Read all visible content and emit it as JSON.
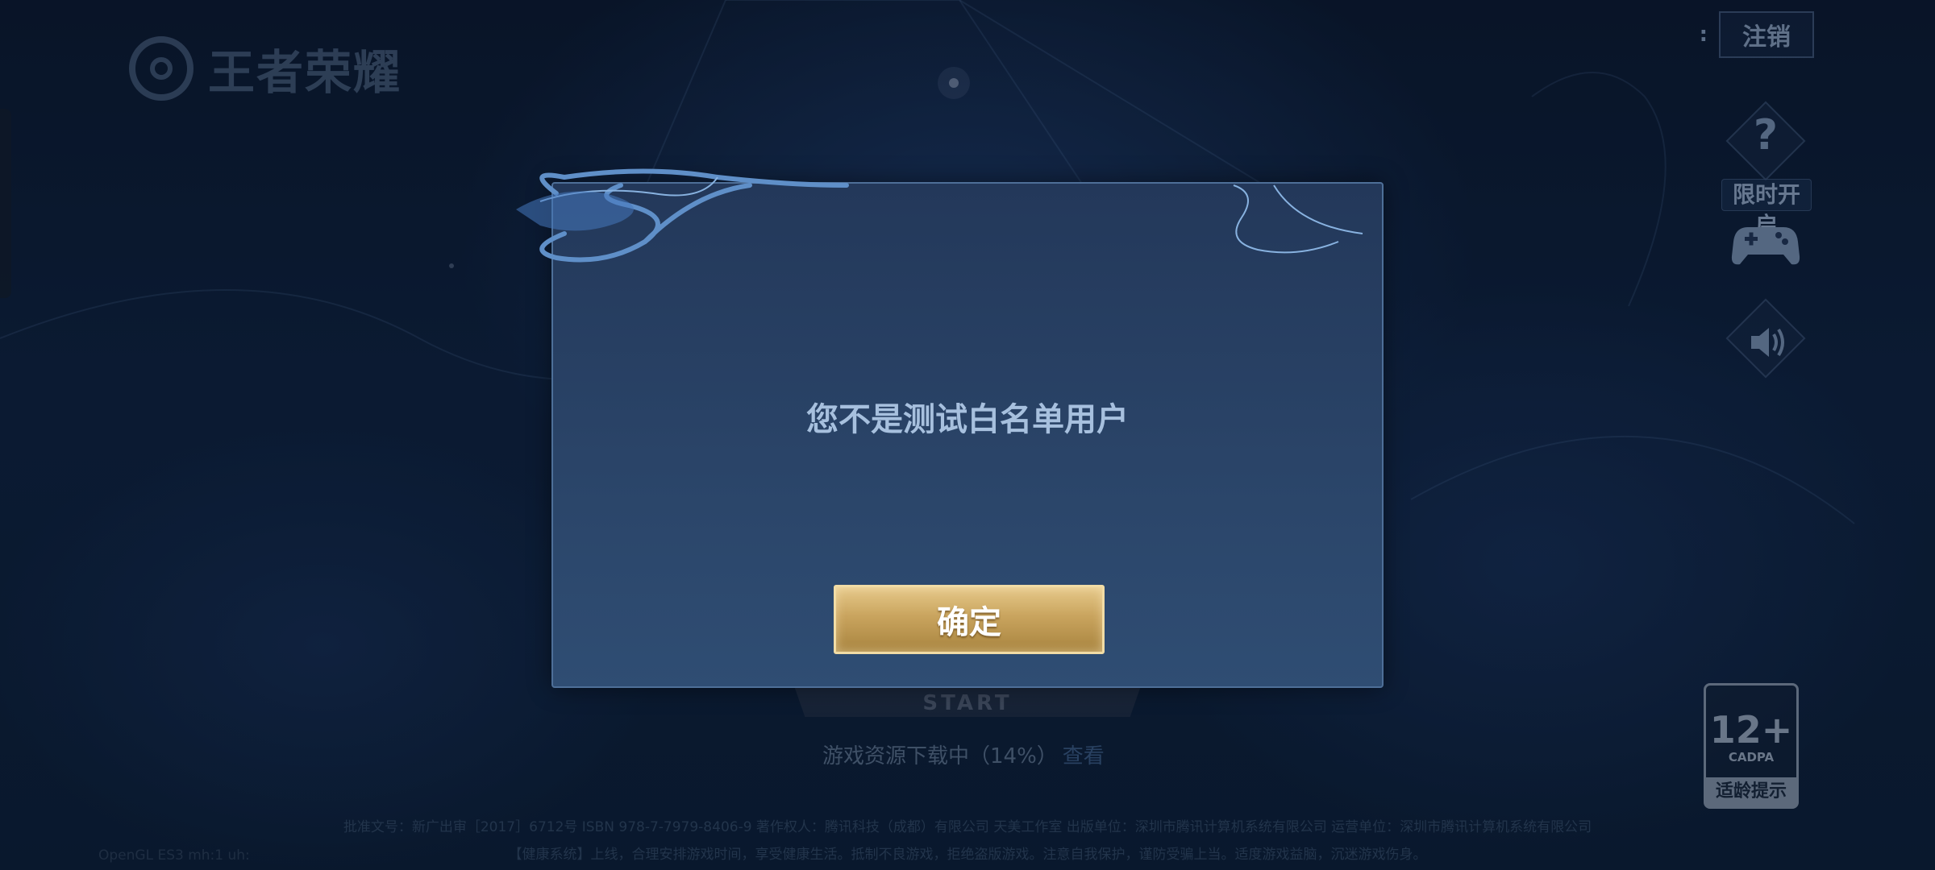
{
  "header": {
    "logo_text": "王者荣耀",
    "separator": ":",
    "logout_label": "注销"
  },
  "side_menu": {
    "help_symbol": "?",
    "limited_label": "限时开启"
  },
  "start_panel": {
    "start_label": "START",
    "download_status": "游戏资源下载中（14%）",
    "view_link": "查看"
  },
  "footer": {
    "line1": "批准文号：新广出审［2017］6712号  ISBN 978-7-7979-8406-9  著作权人：腾讯科技（成都）有限公司 天美工作室  出版单位：深圳市腾讯计算机系统有限公司  运营单位：深圳市腾讯计算机系统有限公司",
    "line2": "【健康系统】上线，合理安排游戏时间，享受健康生活。抵制不良游戏，拒绝盗版游戏。注意自我保护，谨防受骗上当。适度游戏益脑，沉迷游戏伤身。",
    "gl_info": "OpenGL ES3 mh:1 uh:"
  },
  "age_rating": {
    "age": "12+",
    "org": "CADPA",
    "tip": "适龄提示"
  },
  "dialog": {
    "message": "您不是测试白名单用户",
    "confirm_label": "确定"
  },
  "colors": {
    "dialog_bg": "#2a4468",
    "dialog_border": "#4e6f98",
    "button_gold": "#c9a45e",
    "text_light_blue": "#a7c0de"
  },
  "icons": [
    "logo-icon",
    "help-icon",
    "gamepad-icon",
    "speaker-icon"
  ]
}
